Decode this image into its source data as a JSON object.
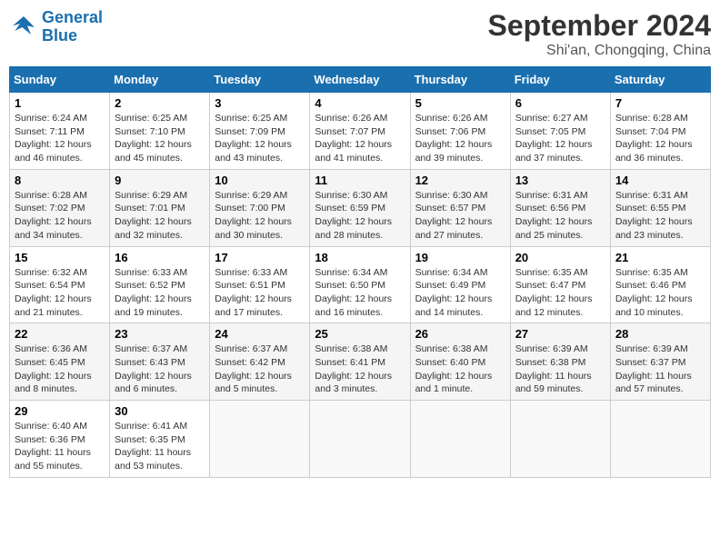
{
  "header": {
    "logo_line1": "General",
    "logo_line2": "Blue",
    "month": "September 2024",
    "location": "Shi'an, Chongqing, China"
  },
  "weekdays": [
    "Sunday",
    "Monday",
    "Tuesday",
    "Wednesday",
    "Thursday",
    "Friday",
    "Saturday"
  ],
  "weeks": [
    [
      {
        "day": "1",
        "sunrise": "6:24 AM",
        "sunset": "7:11 PM",
        "daylight": "12 hours and 46 minutes."
      },
      {
        "day": "2",
        "sunrise": "6:25 AM",
        "sunset": "7:10 PM",
        "daylight": "12 hours and 45 minutes."
      },
      {
        "day": "3",
        "sunrise": "6:25 AM",
        "sunset": "7:09 PM",
        "daylight": "12 hours and 43 minutes."
      },
      {
        "day": "4",
        "sunrise": "6:26 AM",
        "sunset": "7:07 PM",
        "daylight": "12 hours and 41 minutes."
      },
      {
        "day": "5",
        "sunrise": "6:26 AM",
        "sunset": "7:06 PM",
        "daylight": "12 hours and 39 minutes."
      },
      {
        "day": "6",
        "sunrise": "6:27 AM",
        "sunset": "7:05 PM",
        "daylight": "12 hours and 37 minutes."
      },
      {
        "day": "7",
        "sunrise": "6:28 AM",
        "sunset": "7:04 PM",
        "daylight": "12 hours and 36 minutes."
      }
    ],
    [
      {
        "day": "8",
        "sunrise": "6:28 AM",
        "sunset": "7:02 PM",
        "daylight": "12 hours and 34 minutes."
      },
      {
        "day": "9",
        "sunrise": "6:29 AM",
        "sunset": "7:01 PM",
        "daylight": "12 hours and 32 minutes."
      },
      {
        "day": "10",
        "sunrise": "6:29 AM",
        "sunset": "7:00 PM",
        "daylight": "12 hours and 30 minutes."
      },
      {
        "day": "11",
        "sunrise": "6:30 AM",
        "sunset": "6:59 PM",
        "daylight": "12 hours and 28 minutes."
      },
      {
        "day": "12",
        "sunrise": "6:30 AM",
        "sunset": "6:57 PM",
        "daylight": "12 hours and 27 minutes."
      },
      {
        "day": "13",
        "sunrise": "6:31 AM",
        "sunset": "6:56 PM",
        "daylight": "12 hours and 25 minutes."
      },
      {
        "day": "14",
        "sunrise": "6:31 AM",
        "sunset": "6:55 PM",
        "daylight": "12 hours and 23 minutes."
      }
    ],
    [
      {
        "day": "15",
        "sunrise": "6:32 AM",
        "sunset": "6:54 PM",
        "daylight": "12 hours and 21 minutes."
      },
      {
        "day": "16",
        "sunrise": "6:33 AM",
        "sunset": "6:52 PM",
        "daylight": "12 hours and 19 minutes."
      },
      {
        "day": "17",
        "sunrise": "6:33 AM",
        "sunset": "6:51 PM",
        "daylight": "12 hours and 17 minutes."
      },
      {
        "day": "18",
        "sunrise": "6:34 AM",
        "sunset": "6:50 PM",
        "daylight": "12 hours and 16 minutes."
      },
      {
        "day": "19",
        "sunrise": "6:34 AM",
        "sunset": "6:49 PM",
        "daylight": "12 hours and 14 minutes."
      },
      {
        "day": "20",
        "sunrise": "6:35 AM",
        "sunset": "6:47 PM",
        "daylight": "12 hours and 12 minutes."
      },
      {
        "day": "21",
        "sunrise": "6:35 AM",
        "sunset": "6:46 PM",
        "daylight": "12 hours and 10 minutes."
      }
    ],
    [
      {
        "day": "22",
        "sunrise": "6:36 AM",
        "sunset": "6:45 PM",
        "daylight": "12 hours and 8 minutes."
      },
      {
        "day": "23",
        "sunrise": "6:37 AM",
        "sunset": "6:43 PM",
        "daylight": "12 hours and 6 minutes."
      },
      {
        "day": "24",
        "sunrise": "6:37 AM",
        "sunset": "6:42 PM",
        "daylight": "12 hours and 5 minutes."
      },
      {
        "day": "25",
        "sunrise": "6:38 AM",
        "sunset": "6:41 PM",
        "daylight": "12 hours and 3 minutes."
      },
      {
        "day": "26",
        "sunrise": "6:38 AM",
        "sunset": "6:40 PM",
        "daylight": "12 hours and 1 minute."
      },
      {
        "day": "27",
        "sunrise": "6:39 AM",
        "sunset": "6:38 PM",
        "daylight": "11 hours and 59 minutes."
      },
      {
        "day": "28",
        "sunrise": "6:39 AM",
        "sunset": "6:37 PM",
        "daylight": "11 hours and 57 minutes."
      }
    ],
    [
      {
        "day": "29",
        "sunrise": "6:40 AM",
        "sunset": "6:36 PM",
        "daylight": "11 hours and 55 minutes."
      },
      {
        "day": "30",
        "sunrise": "6:41 AM",
        "sunset": "6:35 PM",
        "daylight": "11 hours and 53 minutes."
      },
      null,
      null,
      null,
      null,
      null
    ]
  ]
}
